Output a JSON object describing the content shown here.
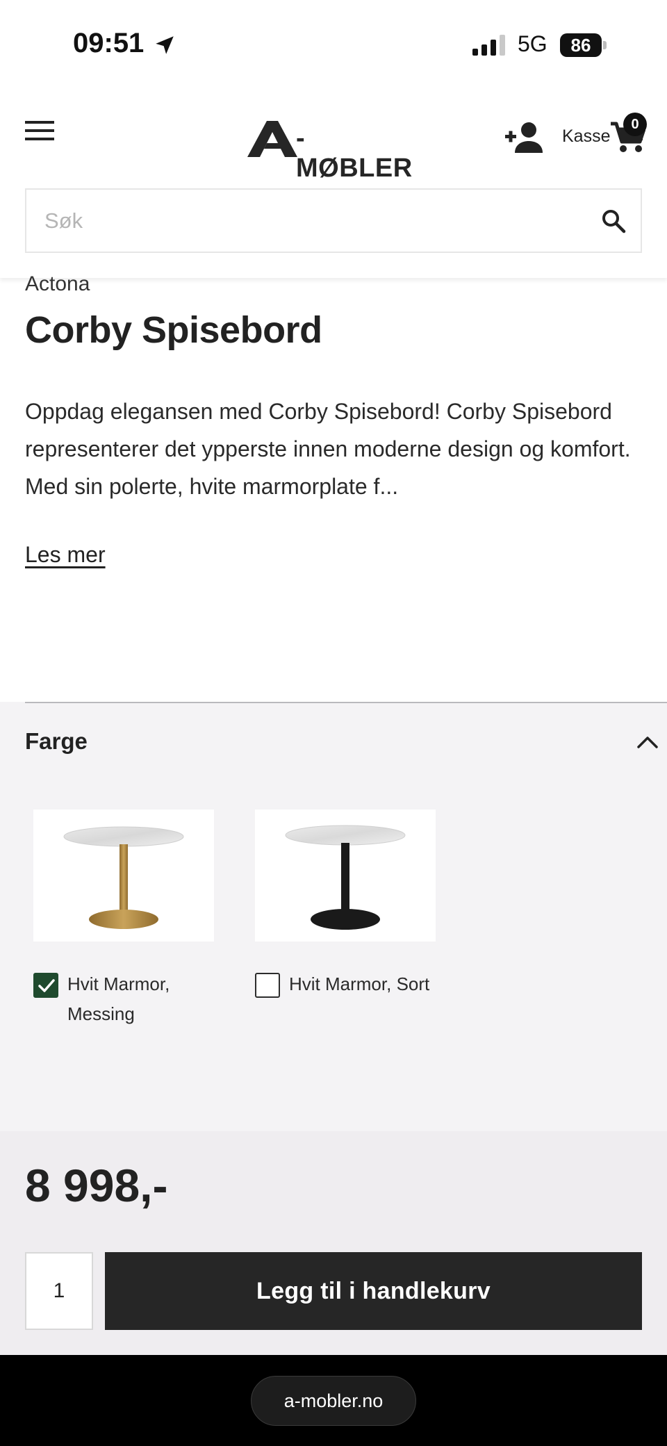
{
  "status_bar": {
    "time": "09:51",
    "network": "5G",
    "battery": "86"
  },
  "header": {
    "logo_text": "-MØBLER",
    "cart_label": "Kasse",
    "cart_count": "0",
    "search_placeholder": "Søk"
  },
  "product": {
    "brand": "Actona",
    "title": "Corby Spisebord",
    "description": "Oppdag elegansen med Corby Spisebord! Corby Spisebord representerer det ypperste innen moderne design og komfort. Med sin polerte, hvite marmorplate f...",
    "read_more": "Les mer"
  },
  "color_section": {
    "heading": "Farge",
    "options": [
      {
        "label": "Hvit Marmor, Messing",
        "selected": true,
        "base_color": "#b08a45"
      },
      {
        "label": "Hvit Marmor, Sort",
        "selected": false,
        "base_color": "#1a1a1a"
      }
    ]
  },
  "purchase": {
    "price": "8 998,-",
    "quantity": "1",
    "add_to_cart": "Legg til i handlekurv"
  },
  "browser": {
    "url": "a-mobler.no"
  },
  "colors": {
    "accent_dark": "#262626",
    "checkbox_green": "#1f4a2e"
  }
}
